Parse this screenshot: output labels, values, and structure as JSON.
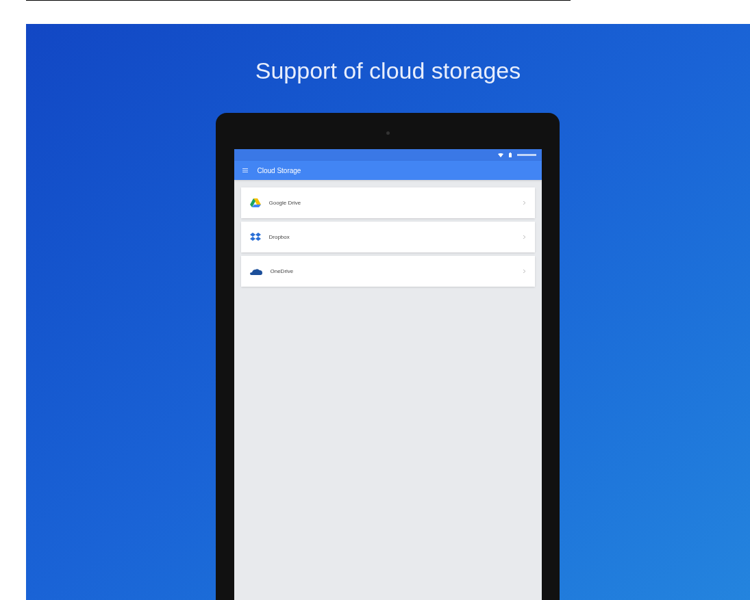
{
  "headline": "Support of cloud storages",
  "app_bar": {
    "title": "Cloud Storage"
  },
  "storages": [
    {
      "kind": "drive",
      "label": "Google Drive"
    },
    {
      "kind": "dropbox",
      "label": "Dropbox"
    },
    {
      "kind": "onedrive",
      "label": "OneDrive"
    }
  ]
}
